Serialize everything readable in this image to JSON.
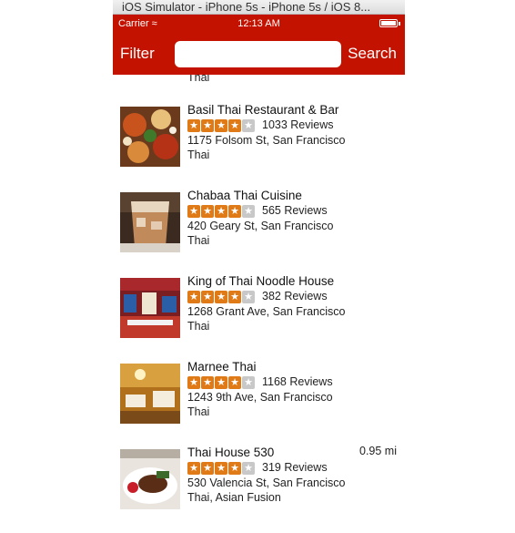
{
  "window": {
    "title": "iOS Simulator - iPhone 5s - iPhone 5s / iOS 8..."
  },
  "statusbar": {
    "carrier": "Carrier ≈",
    "time": "12:13 AM"
  },
  "navbar": {
    "filter_label": "Filter",
    "search_label": "Search",
    "search_value": "",
    "search_placeholder": ""
  },
  "top_partial": {
    "category": "Thai"
  },
  "results": [
    {
      "name": "Basil Thai Restaurant & Bar",
      "rating": 4,
      "reviews": "1033 Reviews",
      "address": "1175 Folsom St, San Francisco",
      "category": "Thai",
      "distance": ""
    },
    {
      "name": "Chabaa Thai Cuisine",
      "rating": 4,
      "reviews": "565 Reviews",
      "address": "420 Geary St, San Francisco",
      "category": "Thai",
      "distance": ""
    },
    {
      "name": "King of Thai Noodle House",
      "rating": 4,
      "reviews": "382 Reviews",
      "address": "1268 Grant Ave, San Francisco",
      "category": "Thai",
      "distance": ""
    },
    {
      "name": "Marnee Thai",
      "rating": 4,
      "reviews": "1168 Reviews",
      "address": "1243 9th Ave, San Francisco",
      "category": "Thai",
      "distance": ""
    },
    {
      "name": "Thai House 530",
      "rating": 4,
      "reviews": "319 Reviews",
      "address": "530 Valencia St, San Francisco",
      "category": "Thai, Asian Fusion",
      "distance": "0.95 mi"
    }
  ],
  "colors": {
    "brand_red": "#c41200",
    "star_orange": "#e07a16",
    "star_off": "#c8c8c8"
  }
}
